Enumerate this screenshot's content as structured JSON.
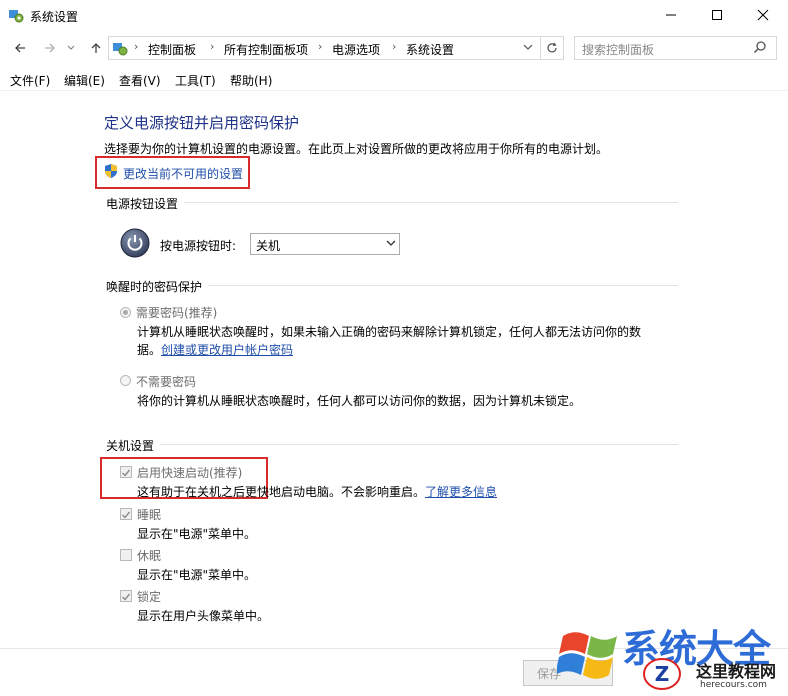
{
  "window": {
    "title": "系统设置"
  },
  "address": {
    "crumbs": [
      "控制面板",
      "所有控制面板项",
      "电源选项",
      "系统设置"
    ]
  },
  "search": {
    "placeholder": "搜索控制面板"
  },
  "menu": [
    "文件(F)",
    "编辑(E)",
    "查看(V)",
    "工具(T)",
    "帮助(H)"
  ],
  "content": {
    "title": "定义电源按钮并启用密码保护",
    "description": "选择要为你的计算机设置的电源设置。在此页上对设置所做的更改将应用于你所有的电源计划。",
    "change_link": "更改当前不可用的设置",
    "power_section": "电源按钮设置",
    "power_label": "按电源按钮时:",
    "power_select_value": "关机",
    "wake_section": "唤醒时的密码保护",
    "require_password": {
      "label": "需要密码(推荐)",
      "desc_line1": "计算机从睡眠状态唤醒时，如果未输入正确的密码来解除计算机锁定，任何人都无法访问你的数",
      "desc_line2_prefix": "据。",
      "desc_link": "创建或更改用户帐户密码",
      "selected": true
    },
    "no_password": {
      "label": "不需要密码",
      "desc": "将你的计算机从睡眠状态唤醒时，任何人都可以访问你的数据，因为计算机未锁定。",
      "selected": false
    },
    "shutdown_section": "关机设置",
    "fast_startup": {
      "label": "启用快速启动(推荐)",
      "desc": "这有助于在关机之后更快地启动电脑。不会影响重启。",
      "link": "了解更多信息",
      "checked": true
    },
    "sleep": {
      "label": "睡眠",
      "desc": "显示在\"电源\"菜单中。",
      "checked": true
    },
    "hibernate": {
      "label": "休眠",
      "desc": "显示在\"电源\"菜单中。",
      "checked": false
    },
    "lock": {
      "label": "锁定",
      "desc": "显示在用户头像菜单中。",
      "checked": true
    }
  },
  "footer": {
    "save_label": "保存"
  },
  "watermark": {
    "brand": "系统大全",
    "site_cn": "这里教程网",
    "site_en": "herecours.com"
  },
  "colors": {
    "title_blue": "#1e3287",
    "link_blue": "#1f4eaa",
    "highlight_red": "#d92b2b"
  }
}
